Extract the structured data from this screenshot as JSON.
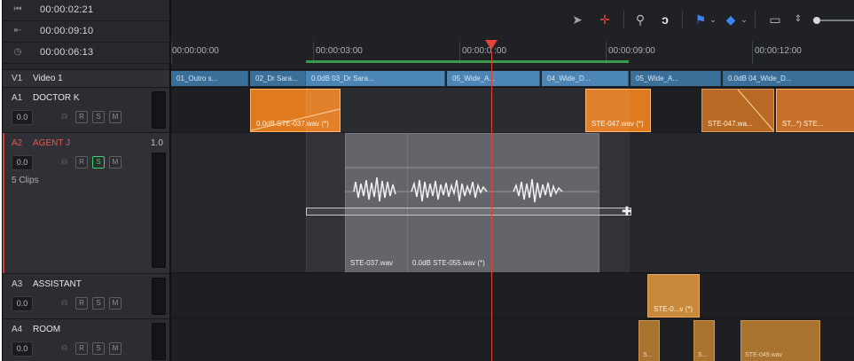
{
  "timecodes": {
    "row1": "00:00:02:21",
    "row2": "00:00:09:10",
    "row3": "00:00:06:13"
  },
  "ruler": {
    "ticks": [
      "00:00:00:00",
      "00:00:03:00",
      "00:00:0 :00",
      "00:00:09:00",
      "00:00:12:00"
    ]
  },
  "tracks": {
    "v1": {
      "id": "V1",
      "name": "Video 1"
    },
    "a1": {
      "id": "A1",
      "name": "DOCTOR K",
      "volume": "0.0"
    },
    "a2": {
      "id": "A2",
      "name": "AGENT J",
      "level": "1.0",
      "volume": "0.0",
      "clips": "5 Clips"
    },
    "a3": {
      "id": "A3",
      "name": "ASSISTANT",
      "volume": "0.0"
    },
    "a4": {
      "id": "A4",
      "name": "ROOM",
      "volume": "0.0"
    }
  },
  "buttons": {
    "r": "R",
    "s": "S",
    "m": "M"
  },
  "video_clips": [
    "01_Outro s...",
    "02_Dr Sara...",
    "0.0dB   03_Dr Sara...",
    "05_Wide_A...",
    "04_Wide_D...",
    "05_Wide_A...",
    "0.0dB   04_Wide_D..."
  ],
  "a1_clips": [
    "0.0dB   STE-037.wav (*)",
    "STE-047.wav (*)",
    "STE-047.wa...",
    "ST...*)  STE..."
  ],
  "a2_clips": [
    "STE-037.wav",
    "0.0dB   STE-055.wav (*)"
  ],
  "a3_clips": [
    "STE-0...v (*)"
  ],
  "a4_clips": [
    "S...",
    "S...",
    "STE-049.wav"
  ],
  "colors": {
    "orange": "#e07a1f",
    "video": "#4b86b6",
    "playhead": "#e2443b",
    "agent": "#e05a52"
  },
  "icons": [
    "pointer-icon",
    "blade-icon",
    "link-icon",
    "snap-icon",
    "flag-icon",
    "marker-icon",
    "zoom-icon",
    "slider-icon"
  ]
}
